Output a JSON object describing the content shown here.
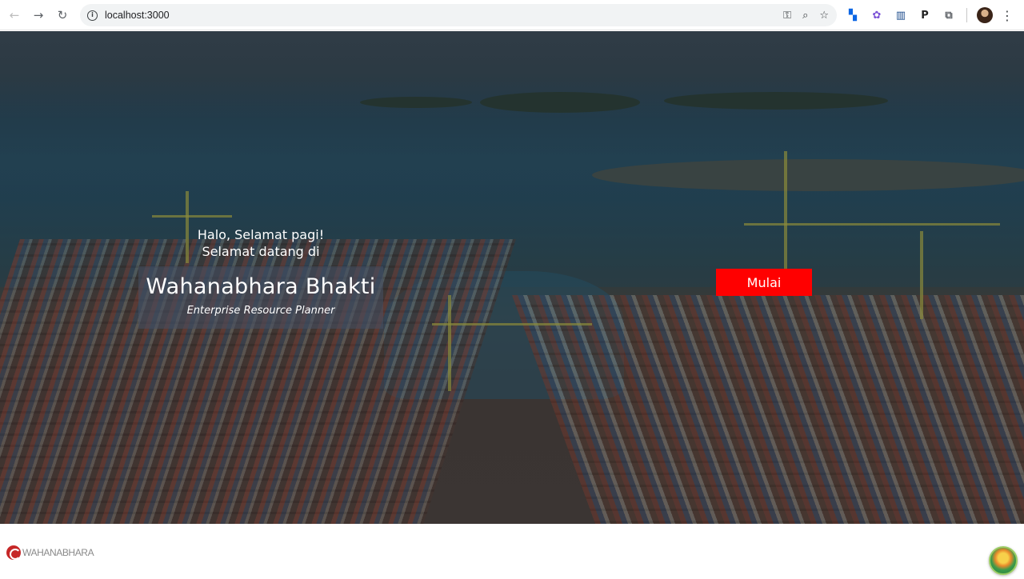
{
  "browser": {
    "url": "localhost:3000",
    "icons": [
      "back-icon",
      "forward-icon",
      "reload-icon",
      "site-info-icon",
      "password-key-icon",
      "zoom-icon",
      "bookmark-star-icon",
      "trello-extension-icon",
      "multi-extension-icon",
      "book-extension-icon",
      "p-extension-icon",
      "extensions-puzzle-icon",
      "profile-avatar",
      "menu-kebab-icon"
    ]
  },
  "hero": {
    "greeting_line1": "Halo, Selamat pagi!",
    "greeting_line2": "Selamat datang di",
    "title": "Wahanabhara Bhakti",
    "subtitle": "Enterprise Resource Planner",
    "start_button": "Mulai",
    "accent_color": "#ff0000"
  },
  "footer": {
    "brand": "WAHANABHARA"
  }
}
